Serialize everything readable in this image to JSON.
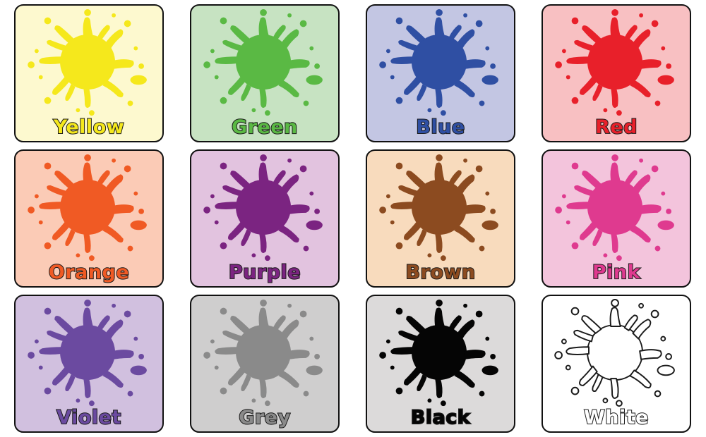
{
  "cards": [
    {
      "label": "Yellow",
      "color": "#f5e81c",
      "bg": "#fdf9cf"
    },
    {
      "label": "Green",
      "color": "#5ab944",
      "bg": "#c7e3c2"
    },
    {
      "label": "Blue",
      "color": "#2f4fa3",
      "bg": "#c3c6e3"
    },
    {
      "label": "Red",
      "color": "#e8202a",
      "bg": "#f8c0c2"
    },
    {
      "label": "Orange",
      "color": "#f05a24",
      "bg": "#fbcbb6"
    },
    {
      "label": "Purple",
      "color": "#7b2481",
      "bg": "#e2c3df"
    },
    {
      "label": "Brown",
      "color": "#8c4b20",
      "bg": "#f8dbbd"
    },
    {
      "label": "Pink",
      "color": "#df3a8f",
      "bg": "#f3c4dc"
    },
    {
      "label": "Violet",
      "color": "#6b4aa0",
      "bg": "#d1c0df"
    },
    {
      "label": "Grey",
      "color": "#8a8a8a",
      "bg": "#cfcece"
    },
    {
      "label": "Black",
      "color": "#050505",
      "bg": "#dcdada"
    },
    {
      "label": "White",
      "color": "#ffffff",
      "bg": "#ffffff"
    }
  ]
}
